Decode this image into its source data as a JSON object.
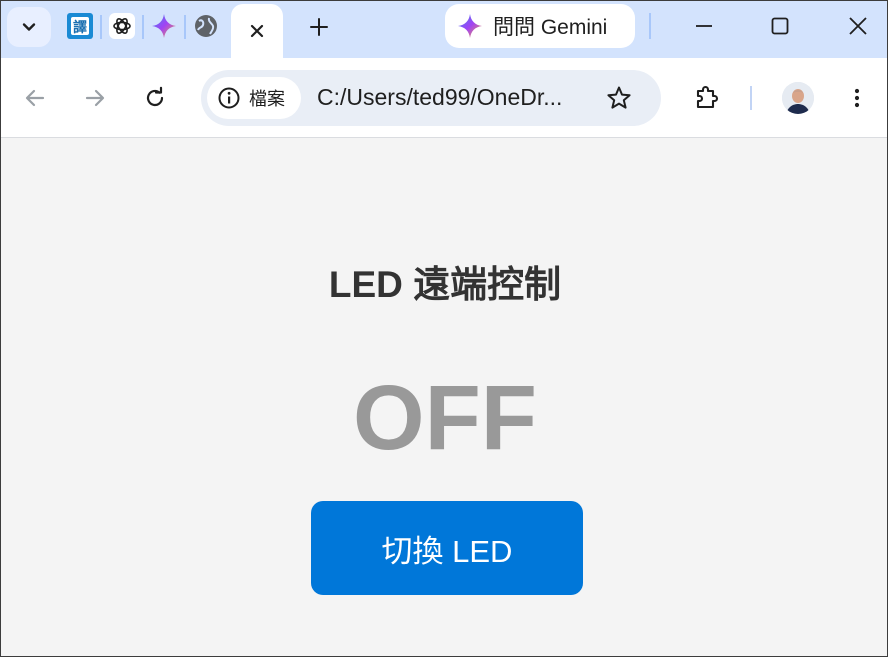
{
  "browser": {
    "gemini_button_label": "問問 Gemini",
    "site_chip_label": "檔案",
    "url": "C:/Users/ted99/OneDr...",
    "pinned_tabs": [
      "translate-favicon",
      "chatgpt-favicon",
      "gemini-favicon",
      "globe-favicon"
    ]
  },
  "page": {
    "title": "LED 遠端控制",
    "status": "OFF",
    "toggle_button_label": "切換 LED"
  },
  "colors": {
    "tabstrip_bg": "#d3e3fd",
    "omnibox_bg": "#e9eef6",
    "page_bg": "#f4f4f4",
    "title_color": "#333333",
    "status_off_color": "#999999",
    "button_bg": "#0077d9",
    "button_text": "#ffffff"
  }
}
